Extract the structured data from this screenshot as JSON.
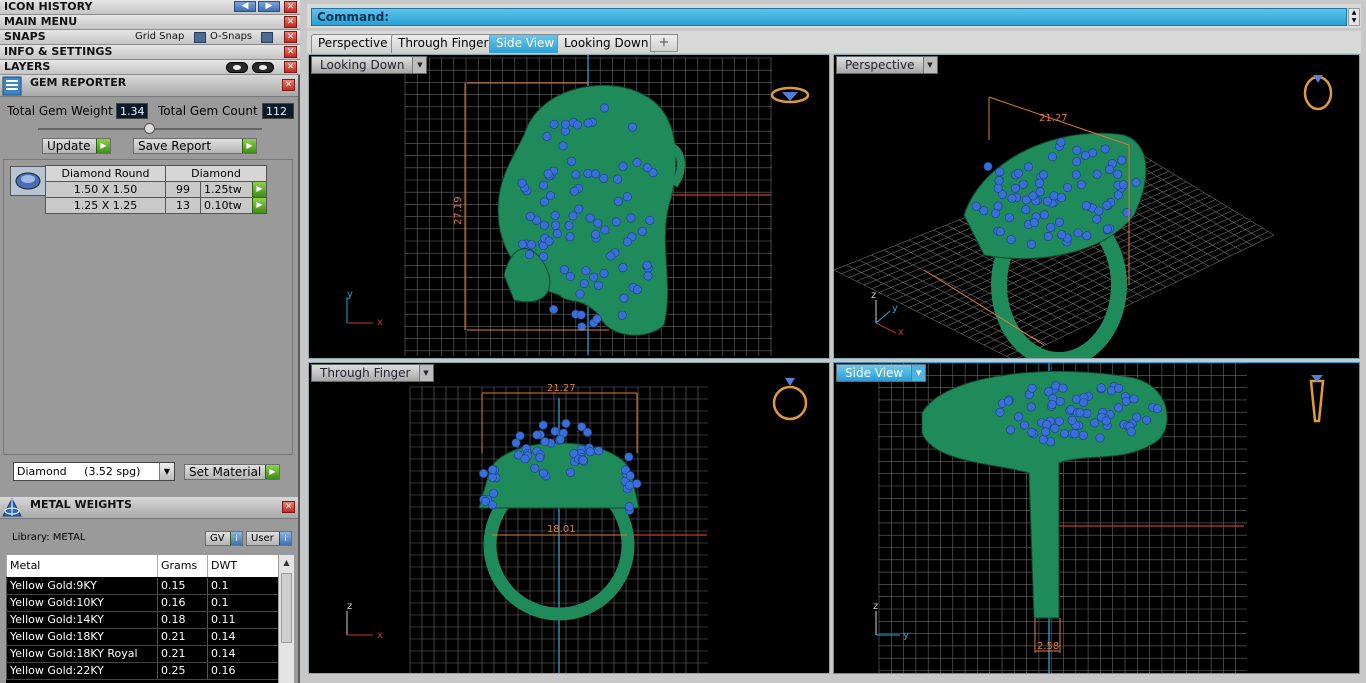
{
  "left": {
    "bars": {
      "icon_history": "ICON HISTORY",
      "main_menu": "MAIN MENU",
      "snaps": "SNAPS",
      "info_settings": "INFO & SETTINGS",
      "layers": "LAYERS"
    },
    "snaps": {
      "grid_snap": "Grid Snap",
      "o_snaps": "O-Snaps"
    },
    "gem_reporter": {
      "title": "GEM REPORTER",
      "total_weight_label": "Total Gem Weight",
      "total_weight": "1.34",
      "total_count_label": "Total Gem Count",
      "total_count": "112",
      "update": "Update",
      "save_report": "Save Report",
      "header_cut": "Diamond Round",
      "header_material": "Diamond",
      "rows": [
        {
          "size": "1.50 X 1.50",
          "count": "99",
          "weight": "1.25tw"
        },
        {
          "size": "1.25 X 1.25",
          "count": "13",
          "weight": "0.10tw"
        }
      ],
      "material": "Diamond     (3.52 spg)",
      "set_material": "Set Material"
    },
    "metal_weights": {
      "title": "METAL WEIGHTS",
      "library": "Library: METAL",
      "gv": "GV",
      "user": "User",
      "columns": [
        "Metal",
        "Grams",
        "DWT"
      ],
      "rows": [
        [
          "Yellow Gold:9KY",
          "0.15",
          "0.1"
        ],
        [
          "Yellow Gold:10KY",
          "0.16",
          "0.1"
        ],
        [
          "Yellow Gold:14KY",
          "0.18",
          "0.11"
        ],
        [
          "Yellow Gold:18KY",
          "0.21",
          "0.14"
        ],
        [
          "Yellow Gold:18KY Royal",
          "0.21",
          "0.14"
        ],
        [
          "Yellow Gold:22KY",
          "0.25",
          "0.16"
        ]
      ]
    }
  },
  "command": {
    "label": "Command:"
  },
  "tabs": [
    "Perspective",
    "Through Finger",
    "Side View",
    "Looking Down"
  ],
  "active_tab": "Side View",
  "tab_plus": "+",
  "viewports": {
    "looking_down": {
      "label": "Looking Down",
      "dim": "27.19"
    },
    "perspective": {
      "label": "Perspective",
      "dim": "21.27"
    },
    "through_finger": {
      "label": "Through Finger",
      "dim_top": "21.27",
      "dim_inner": "18.01"
    },
    "side_view": {
      "label": "Side View",
      "dim": "2.58"
    }
  },
  "axes": {
    "x": "x",
    "y": "y",
    "z": "z"
  },
  "colors": {
    "ring_green": "#1f8a5a",
    "gem_blue": "#3a6fd8",
    "dim_orange": "#e07a3a",
    "grid_gray": "#6a6a6a",
    "accent_blue": "#2aa3d8"
  }
}
